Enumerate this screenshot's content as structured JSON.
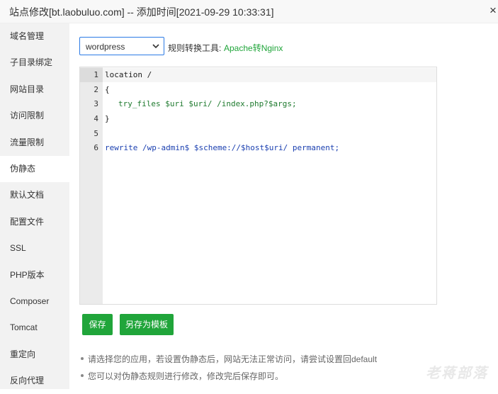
{
  "window": {
    "title": "站点修改[bt.laobuluo.com] -- 添加时间[2021-09-29 10:33:31]",
    "close_glyph": "×"
  },
  "sidebar": {
    "items": [
      {
        "label": "域名管理"
      },
      {
        "label": "子目录绑定"
      },
      {
        "label": "网站目录"
      },
      {
        "label": "访问限制"
      },
      {
        "label": "流量限制"
      },
      {
        "label": "伪静态",
        "active": true
      },
      {
        "label": "默认文档"
      },
      {
        "label": "配置文件"
      },
      {
        "label": "SSL"
      },
      {
        "label": "PHP版本"
      },
      {
        "label": "Composer"
      },
      {
        "label": "Tomcat"
      },
      {
        "label": "重定向"
      },
      {
        "label": "反向代理"
      }
    ]
  },
  "toolbar": {
    "template_select": {
      "value": "wordpress"
    },
    "convert_label": "规则转换工具:",
    "convert_link": "Apache转Nginx"
  },
  "editor": {
    "line_numbers": [
      "1",
      "2",
      "3",
      "4",
      "5",
      "6"
    ],
    "lines": [
      "location /",
      "{",
      "try_files $uri $uri/ /index.php?$args;",
      "}",
      "",
      "rewrite /wp-admin$ $scheme://$host$uri/ permanent;"
    ]
  },
  "buttons": {
    "save": "保存",
    "save_as_template": "另存为模板"
  },
  "notes": [
    "请选择您的应用，若设置伪静态后，网站无法正常访问，请尝试设置回default",
    "您可以对伪静态规则进行修改，修改完后保存即可。"
  ],
  "watermark": "老蒋部落",
  "colors": {
    "accent_green": "#20a53a",
    "select_border": "#2c7be5",
    "sidebar_bg": "#f2f2f2"
  }
}
